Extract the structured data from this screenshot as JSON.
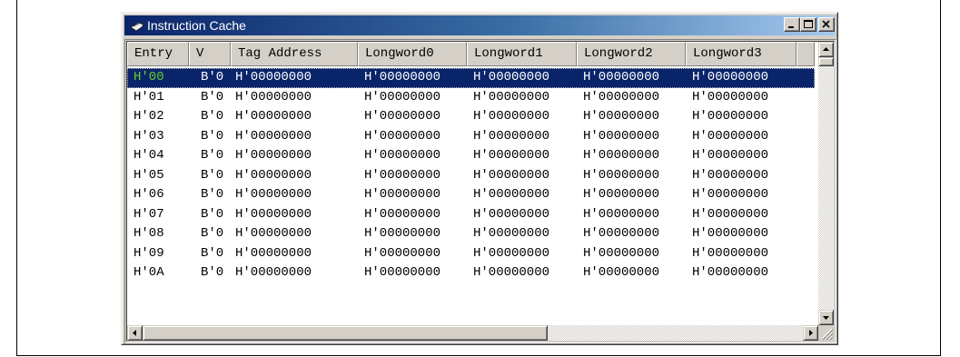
{
  "window": {
    "title": "Instruction Cache",
    "controls": [
      "minimize-icon",
      "maximize-icon",
      "close-icon"
    ]
  },
  "table": {
    "columns": [
      "Entry",
      "V",
      "Tag Address",
      "Longword0",
      "Longword1",
      "Longword2",
      "Longword3"
    ],
    "selected_index": 0,
    "rows": [
      [
        "H'00",
        "B'0",
        "H'00000000",
        "H'00000000",
        "H'00000000",
        "H'00000000",
        "H'00000000"
      ],
      [
        "H'01",
        "B'0",
        "H'00000000",
        "H'00000000",
        "H'00000000",
        "H'00000000",
        "H'00000000"
      ],
      [
        "H'02",
        "B'0",
        "H'00000000",
        "H'00000000",
        "H'00000000",
        "H'00000000",
        "H'00000000"
      ],
      [
        "H'03",
        "B'0",
        "H'00000000",
        "H'00000000",
        "H'00000000",
        "H'00000000",
        "H'00000000"
      ],
      [
        "H'04",
        "B'0",
        "H'00000000",
        "H'00000000",
        "H'00000000",
        "H'00000000",
        "H'00000000"
      ],
      [
        "H'05",
        "B'0",
        "H'00000000",
        "H'00000000",
        "H'00000000",
        "H'00000000",
        "H'00000000"
      ],
      [
        "H'06",
        "B'0",
        "H'00000000",
        "H'00000000",
        "H'00000000",
        "H'00000000",
        "H'00000000"
      ],
      [
        "H'07",
        "B'0",
        "H'00000000",
        "H'00000000",
        "H'00000000",
        "H'00000000",
        "H'00000000"
      ],
      [
        "H'08",
        "B'0",
        "H'00000000",
        "H'00000000",
        "H'00000000",
        "H'00000000",
        "H'00000000"
      ],
      [
        "H'09",
        "B'0",
        "H'00000000",
        "H'00000000",
        "H'00000000",
        "H'00000000",
        "H'00000000"
      ],
      [
        "H'0A",
        "B'0",
        "H'00000000",
        "H'00000000",
        "H'00000000",
        "H'00000000",
        "H'00000000"
      ]
    ]
  },
  "colors": {
    "title_start": "#0a246a",
    "title_end": "#a6caf0",
    "selection": "#0a246a",
    "selected_entry_text": "#66cc33"
  }
}
